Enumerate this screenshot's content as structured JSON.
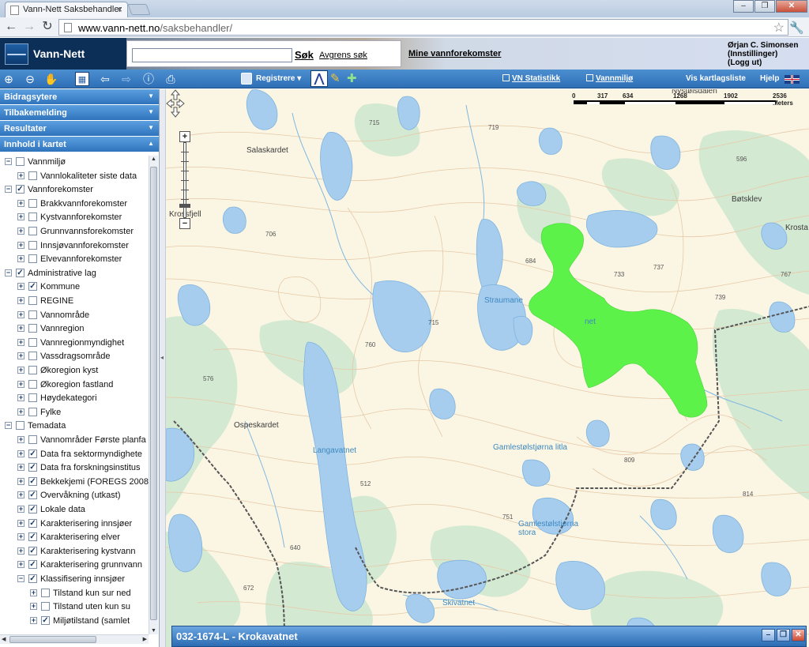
{
  "browser": {
    "tab_title": "Vann-Nett Saksbehandler",
    "url_host": "www.vann-nett.no",
    "url_path": "/saksbehandler/"
  },
  "header": {
    "app_name": "Vann-Nett",
    "search_placeholder": "",
    "search_button": "Søk",
    "refine_search": "Avgrens søk",
    "my_waterbodies": "Mine vannforekomster",
    "user_name": "Ørjan C. Simonsen",
    "user_settings": "(Innstillinger)",
    "user_logout": "(Logg ut)"
  },
  "toolbar": {
    "register_label": "Registrere",
    "vn_stats": "VN Statistikk",
    "water_env": "Vannmiljø",
    "show_layer_list": "Vis kartlagsliste",
    "help": "Hjelp"
  },
  "sidebar": {
    "sections": [
      {
        "label": "Bidragsytere"
      },
      {
        "label": "Tilbakemelding"
      },
      {
        "label": "Resultater"
      },
      {
        "label": "Innhold i kartet"
      }
    ],
    "tree": [
      {
        "level": 0,
        "label": "Vannmiljø",
        "expanded": true,
        "checked": false
      },
      {
        "level": 1,
        "label": "Vannlokaliteter siste data",
        "expanded": false,
        "checked": false
      },
      {
        "level": 0,
        "label": "Vannforekomster",
        "expanded": true,
        "checked": true
      },
      {
        "level": 1,
        "label": "Brakkvannforekomster",
        "expanded": false,
        "checked": false
      },
      {
        "level": 1,
        "label": "Kystvannforekomster",
        "expanded": false,
        "checked": false
      },
      {
        "level": 1,
        "label": "Grunnvannsforekomster",
        "expanded": false,
        "checked": false
      },
      {
        "level": 1,
        "label": "Innsjøvannforekomster",
        "expanded": false,
        "checked": false
      },
      {
        "level": 1,
        "label": "Elvevannforekomster",
        "expanded": false,
        "checked": false
      },
      {
        "level": 0,
        "label": "Administrative lag",
        "expanded": true,
        "checked": true
      },
      {
        "level": 1,
        "label": "Kommune",
        "expanded": false,
        "checked": true
      },
      {
        "level": 1,
        "label": "REGINE",
        "expanded": false,
        "checked": false
      },
      {
        "level": 1,
        "label": "Vannområde",
        "expanded": false,
        "checked": false
      },
      {
        "level": 1,
        "label": "Vannregion",
        "expanded": false,
        "checked": false
      },
      {
        "level": 1,
        "label": "Vannregionmyndighet",
        "expanded": false,
        "checked": false
      },
      {
        "level": 1,
        "label": "Vassdragsområde",
        "expanded": false,
        "checked": false
      },
      {
        "level": 1,
        "label": "Økoregion kyst",
        "expanded": false,
        "checked": false
      },
      {
        "level": 1,
        "label": "Økoregion fastland",
        "expanded": false,
        "checked": false
      },
      {
        "level": 1,
        "label": "Høydekategori",
        "expanded": false,
        "checked": false
      },
      {
        "level": 1,
        "label": "Fylke",
        "expanded": false,
        "checked": false
      },
      {
        "level": 0,
        "label": "Temadata",
        "expanded": true,
        "checked": false
      },
      {
        "level": 1,
        "label": "Vannområder Første planfa",
        "expanded": false,
        "checked": false
      },
      {
        "level": 1,
        "label": "Data fra sektormyndighete",
        "expanded": false,
        "checked": true
      },
      {
        "level": 1,
        "label": "Data fra forskningsinstitus",
        "expanded": false,
        "checked": true
      },
      {
        "level": 1,
        "label": "Bekkekjemi (FOREGS 2008",
        "expanded": false,
        "checked": true
      },
      {
        "level": 1,
        "label": "Overvåkning (utkast)",
        "expanded": false,
        "checked": true
      },
      {
        "level": 1,
        "label": "Lokale data",
        "expanded": false,
        "checked": true
      },
      {
        "level": 1,
        "label": "Karakterisering innsjøer",
        "expanded": false,
        "checked": true
      },
      {
        "level": 1,
        "label": "Karakterisering elver",
        "expanded": false,
        "checked": true
      },
      {
        "level": 1,
        "label": "Karakterisering kystvann",
        "expanded": false,
        "checked": true
      },
      {
        "level": 1,
        "label": "Karakterisering grunnvann",
        "expanded": false,
        "checked": true
      },
      {
        "level": 1,
        "label": "Klassifisering innsjøer",
        "expanded": true,
        "checked": true
      },
      {
        "level": 2,
        "label": "Tilstand kun sur ned",
        "expanded": false,
        "checked": false
      },
      {
        "level": 2,
        "label": "Tilstand uten kun su",
        "expanded": false,
        "checked": false
      },
      {
        "level": 2,
        "label": "Miljøtilstand (samlet",
        "expanded": false,
        "checked": true
      }
    ]
  },
  "map": {
    "scale_labels": [
      "0",
      "317",
      "634",
      "1268",
      "1902",
      "2536 Meters"
    ],
    "place_labels": [
      {
        "text": "Salaskardet",
        "kind": "place"
      },
      {
        "text": "Krossfjell",
        "kind": "place"
      },
      {
        "text": "Straumane",
        "kind": "water"
      },
      {
        "text": "Nystølsdalen",
        "kind": "place"
      },
      {
        "text": "Bøtsklev",
        "kind": "place"
      },
      {
        "text": "Krosta",
        "kind": "place"
      },
      {
        "text": "Ospeskardet",
        "kind": "place"
      },
      {
        "text": "Langavatnet",
        "kind": "water"
      },
      {
        "text": "Gamlestølstjørna litla",
        "kind": "water"
      },
      {
        "text": "Gamlestølstjørna stora",
        "kind": "water"
      },
      {
        "text": "Skivatnet",
        "kind": "water"
      },
      {
        "text": "715",
        "kind": "elev"
      },
      {
        "text": "719",
        "kind": "elev"
      },
      {
        "text": "596",
        "kind": "elev"
      },
      {
        "text": "706",
        "kind": "elev"
      },
      {
        "text": "684",
        "kind": "elev"
      },
      {
        "text": "733",
        "kind": "elev"
      },
      {
        "text": "737",
        "kind": "elev"
      },
      {
        "text": "767",
        "kind": "elev"
      },
      {
        "text": "739",
        "kind": "elev"
      },
      {
        "text": "715",
        "kind": "elev"
      },
      {
        "text": "760",
        "kind": "elev"
      },
      {
        "text": "576",
        "kind": "elev"
      },
      {
        "text": "512",
        "kind": "elev"
      },
      {
        "text": "809",
        "kind": "elev"
      },
      {
        "text": "751",
        "kind": "elev"
      },
      {
        "text": "814",
        "kind": "elev"
      },
      {
        "text": "640",
        "kind": "elev"
      },
      {
        "text": "672",
        "kind": "elev"
      }
    ],
    "selected_feature_label": "net",
    "selected_color": "#5cf24a"
  },
  "infowindow": {
    "title": "032-1674-L - Krokavatnet"
  }
}
